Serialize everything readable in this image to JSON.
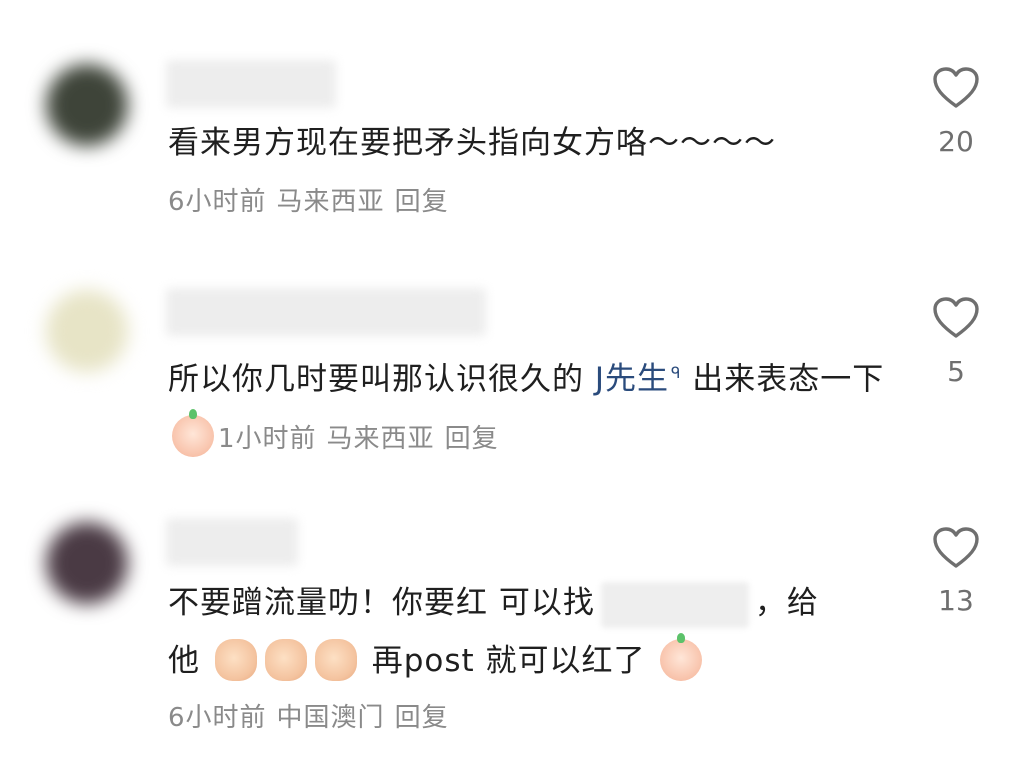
{
  "comments": [
    {
      "text": "看来男方现在要把矛头指向女方咯～～～～",
      "time": "6小时前",
      "location": "马来西亚",
      "reply_label": "回复",
      "likes": "20",
      "avatar_color": "#3e4439"
    },
    {
      "text_before": "所以你几时要叫那认识很久的 ",
      "mention": "J先生",
      "text_after": " 出来表态一下",
      "time": "1小时前",
      "location": "马来西亚",
      "reply_label": "回复",
      "likes": "5",
      "avatar_color": "#e7e4c6"
    },
    {
      "text_line1_a": "不要蹭流量叻！你要红 可以找",
      "text_line1_b": "，给",
      "text_line2_a": "他",
      "text_line2_b": "再post 就可以红了",
      "time": "6小时前",
      "location": "中国澳门",
      "reply_label": "回复",
      "likes": "13",
      "avatar_color": "#4a3a44"
    }
  ],
  "icons": {
    "like": "heart-outline-icon",
    "mention": "search-icon"
  },
  "colors": {
    "text": "#1f1f1f",
    "meta": "#8a8a8a",
    "mention": "#2a4b7c",
    "icon": "#6f6f6f"
  }
}
